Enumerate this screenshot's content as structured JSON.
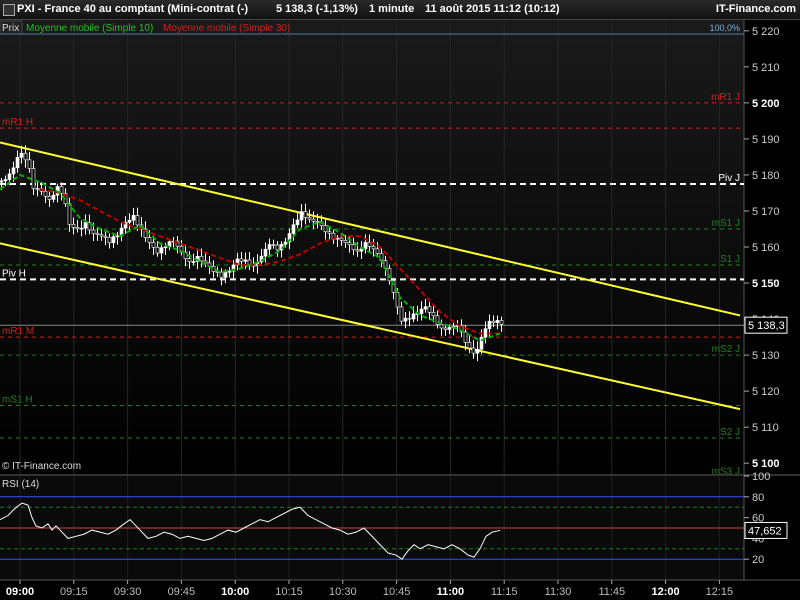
{
  "header": {
    "title": "PXI - France 40 au comptant (Mini-contrat (-)",
    "quote": "5 138,3 (-1,13%)",
    "interval": "1 minute",
    "datetime": "11 août 2015 11:12 (10:12)",
    "brand": "IT-Finance.com"
  },
  "legend": {
    "prix": "Prix",
    "ma10": "Moyenne mobile (Simple 10)",
    "ma30": "Moyenne mobile (Simple 30)",
    "pct": "100,0%"
  },
  "watermark": "© IT-Finance.com",
  "colors": {
    "up": "#ffffff",
    "down": "#000000",
    "ma10": "#00b000",
    "ma30": "#c00000",
    "channel": "#ffff33",
    "resistance": "#d02020",
    "support": "#208020",
    "pivot": "#ffffff",
    "rsi": "#ffffff"
  },
  "chart_data": [
    {
      "type": "candlestick",
      "x_ticks": [
        "09:00",
        "09:15",
        "09:30",
        "09:45",
        "10:00",
        "10:15",
        "10:30",
        "10:45",
        "11:00",
        "11:15",
        "11:30",
        "11:45",
        "12:00",
        "12:15"
      ],
      "y_ticks": [
        "5 220",
        "5 210",
        "5 200",
        "5 190",
        "5 180",
        "5 170",
        "5 160",
        "5 150",
        "5 140",
        "5 130",
        "5 120",
        "5 110",
        "5 100"
      ],
      "ylim": [
        5097,
        5223
      ],
      "last_price": "5 138,3",
      "levels": [
        {
          "label": "mR1 J",
          "value": 5200,
          "kind": "resistance"
        },
        {
          "label": "mR1 H",
          "value": 5193,
          "kind": "resistance"
        },
        {
          "label": "Piv J",
          "value": 5177.5,
          "kind": "pivot"
        },
        {
          "label": "mS1 J",
          "value": 5165,
          "kind": "support"
        },
        {
          "label": "S1 J",
          "value": 5155,
          "kind": "support"
        },
        {
          "label": "Piv H",
          "value": 5151,
          "kind": "pivot"
        },
        {
          "label": "mR1 M",
          "value": 5135,
          "kind": "resistance"
        },
        {
          "label": "mS2 J",
          "value": 5130,
          "kind": "support"
        },
        {
          "label": "mS1 H",
          "value": 5116,
          "kind": "support"
        },
        {
          "label": "S2 J",
          "value": 5107,
          "kind": "support"
        },
        {
          "label": "mS3 J",
          "value": 5096,
          "kind": "support"
        }
      ],
      "channel_upper": [
        [
          0,
          5189
        ],
        [
          740,
          5141
        ]
      ],
      "channel_lower": [
        [
          0,
          5161
        ],
        [
          740,
          5115
        ]
      ],
      "price_path": [
        [
          0,
          5178
        ],
        [
          10,
          5180
        ],
        [
          18,
          5186
        ],
        [
          26,
          5184
        ],
        [
          32,
          5177
        ],
        [
          40,
          5176
        ],
        [
          48,
          5173
        ],
        [
          56,
          5176
        ],
        [
          62,
          5174
        ],
        [
          68,
          5166
        ],
        [
          76,
          5165
        ],
        [
          84,
          5167
        ],
        [
          92,
          5164
        ],
        [
          100,
          5163
        ],
        [
          108,
          5161
        ],
        [
          116,
          5163
        ],
        [
          124,
          5167
        ],
        [
          132,
          5169
        ],
        [
          140,
          5165
        ],
        [
          148,
          5161
        ],
        [
          156,
          5158
        ],
        [
          164,
          5160
        ],
        [
          172,
          5162
        ],
        [
          180,
          5159
        ],
        [
          188,
          5156
        ],
        [
          196,
          5157
        ],
        [
          204,
          5155
        ],
        [
          212,
          5153
        ],
        [
          220,
          5152
        ],
        [
          228,
          5154
        ],
        [
          236,
          5157
        ],
        [
          244,
          5156
        ],
        [
          252,
          5154
        ],
        [
          260,
          5157
        ],
        [
          268,
          5161
        ],
        [
          276,
          5160
        ],
        [
          284,
          5162
        ],
        [
          292,
          5166
        ],
        [
          300,
          5169
        ],
        [
          308,
          5167
        ],
        [
          316,
          5167
        ],
        [
          324,
          5165
        ],
        [
          332,
          5163
        ],
        [
          340,
          5162
        ],
        [
          348,
          5160
        ],
        [
          356,
          5158
        ],
        [
          364,
          5161
        ],
        [
          372,
          5160
        ],
        [
          380,
          5157
        ],
        [
          388,
          5151
        ],
        [
          394,
          5145
        ],
        [
          400,
          5139
        ],
        [
          408,
          5140
        ],
        [
          416,
          5142
        ],
        [
          424,
          5144
        ],
        [
          432,
          5141
        ],
        [
          440,
          5137
        ],
        [
          448,
          5137
        ],
        [
          456,
          5138
        ],
        [
          464,
          5134
        ],
        [
          470,
          5131
        ],
        [
          476,
          5132
        ],
        [
          482,
          5137
        ],
        [
          488,
          5139
        ],
        [
          494,
          5139
        ],
        [
          500,
          5138.3
        ]
      ],
      "ma10_path": [
        [
          0,
          5176
        ],
        [
          20,
          5180
        ],
        [
          40,
          5178
        ],
        [
          60,
          5175
        ],
        [
          80,
          5168
        ],
        [
          100,
          5165
        ],
        [
          120,
          5163
        ],
        [
          140,
          5166
        ],
        [
          160,
          5161
        ],
        [
          180,
          5159
        ],
        [
          200,
          5156
        ],
        [
          220,
          5153
        ],
        [
          240,
          5154
        ],
        [
          260,
          5156
        ],
        [
          280,
          5159
        ],
        [
          300,
          5165
        ],
        [
          320,
          5167
        ],
        [
          340,
          5164
        ],
        [
          360,
          5160
        ],
        [
          380,
          5157
        ],
        [
          400,
          5146
        ],
        [
          420,
          5141
        ],
        [
          440,
          5139
        ],
        [
          460,
          5137
        ],
        [
          480,
          5134
        ],
        [
          500,
          5136
        ]
      ],
      "ma30_path": [
        [
          40,
          5176
        ],
        [
          60,
          5175
        ],
        [
          80,
          5173
        ],
        [
          100,
          5170
        ],
        [
          120,
          5167
        ],
        [
          140,
          5165
        ],
        [
          160,
          5163
        ],
        [
          180,
          5161
        ],
        [
          200,
          5159
        ],
        [
          220,
          5157
        ],
        [
          240,
          5155
        ],
        [
          260,
          5155
        ],
        [
          280,
          5156
        ],
        [
          300,
          5158
        ],
        [
          320,
          5161
        ],
        [
          340,
          5163
        ],
        [
          360,
          5163
        ],
        [
          380,
          5160
        ],
        [
          400,
          5154
        ],
        [
          420,
          5148
        ],
        [
          440,
          5142
        ],
        [
          460,
          5138
        ],
        [
          480,
          5136
        ],
        [
          500,
          5136
        ]
      ]
    },
    {
      "type": "line",
      "title": "RSI (14)",
      "ylim": [
        0,
        100
      ],
      "y_ticks": [
        "100",
        "80",
        "60",
        "40",
        "20"
      ],
      "levels": [
        80,
        70,
        50,
        30,
        20
      ],
      "last_value": "47,652",
      "values": [
        [
          0,
          58
        ],
        [
          8,
          62
        ],
        [
          14,
          68
        ],
        [
          22,
          74
        ],
        [
          28,
          72
        ],
        [
          32,
          60
        ],
        [
          36,
          52
        ],
        [
          42,
          50
        ],
        [
          48,
          54
        ],
        [
          52,
          48
        ],
        [
          56,
          52
        ],
        [
          62,
          46
        ],
        [
          68,
          40
        ],
        [
          76,
          42
        ],
        [
          84,
          44
        ],
        [
          92,
          48
        ],
        [
          100,
          46
        ],
        [
          108,
          44
        ],
        [
          116,
          48
        ],
        [
          124,
          54
        ],
        [
          130,
          58
        ],
        [
          136,
          52
        ],
        [
          142,
          46
        ],
        [
          148,
          40
        ],
        [
          156,
          42
        ],
        [
          164,
          46
        ],
        [
          172,
          44
        ],
        [
          180,
          40
        ],
        [
          188,
          42
        ],
        [
          196,
          40
        ],
        [
          204,
          38
        ],
        [
          212,
          40
        ],
        [
          220,
          44
        ],
        [
          228,
          48
        ],
        [
          236,
          46
        ],
        [
          244,
          50
        ],
        [
          252,
          54
        ],
        [
          260,
          58
        ],
        [
          268,
          56
        ],
        [
          276,
          60
        ],
        [
          284,
          64
        ],
        [
          292,
          68
        ],
        [
          300,
          70
        ],
        [
          308,
          62
        ],
        [
          316,
          58
        ],
        [
          324,
          54
        ],
        [
          332,
          50
        ],
        [
          340,
          48
        ],
        [
          348,
          44
        ],
        [
          356,
          46
        ],
        [
          364,
          50
        ],
        [
          370,
          44
        ],
        [
          376,
          38
        ],
        [
          382,
          32
        ],
        [
          388,
          26
        ],
        [
          396,
          24
        ],
        [
          402,
          20
        ],
        [
          408,
          28
        ],
        [
          414,
          34
        ],
        [
          420,
          30
        ],
        [
          428,
          34
        ],
        [
          436,
          32
        ],
        [
          444,
          30
        ],
        [
          452,
          34
        ],
        [
          460,
          30
        ],
        [
          468,
          24
        ],
        [
          474,
          22
        ],
        [
          480,
          30
        ],
        [
          486,
          42
        ],
        [
          492,
          46
        ],
        [
          500,
          47.652
        ]
      ]
    }
  ]
}
